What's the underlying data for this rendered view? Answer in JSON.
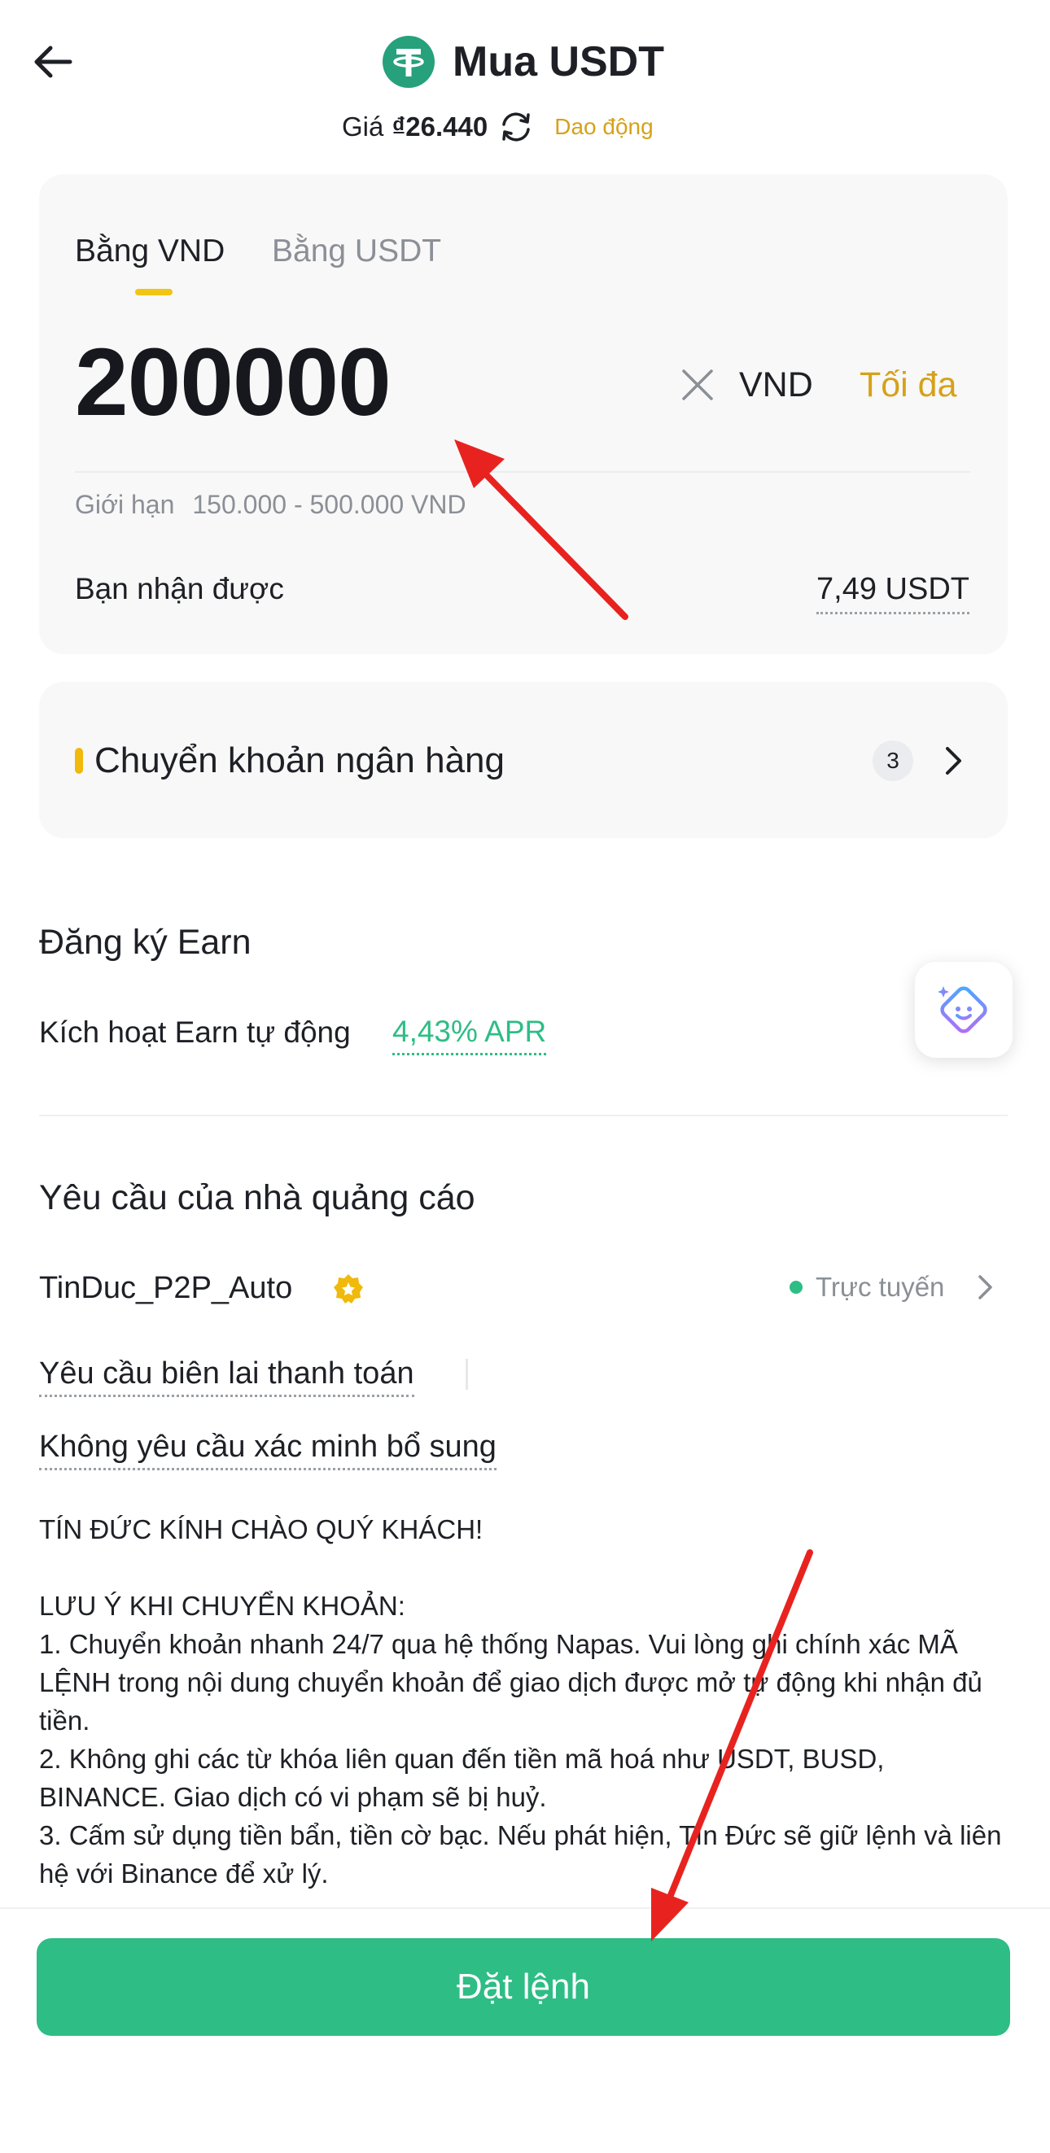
{
  "header": {
    "title": "Mua USDT",
    "price_label": "Giá",
    "price_value": "₫26.440",
    "volatility_label": "Dao động"
  },
  "amount_card": {
    "tabs": [
      {
        "label": "Bằng VND",
        "active": true
      },
      {
        "label": "Bằng USDT",
        "active": false
      }
    ],
    "amount_value": "200000",
    "currency": "VND",
    "max_label": "Tối đa",
    "limit_label": "Giới hạn",
    "limit_value": "150.000 - 500.000 VND",
    "receive_label": "Bạn nhận được",
    "receive_value": "7,49 USDT"
  },
  "payment": {
    "method": "Chuyển khoản ngân hàng",
    "count": "3"
  },
  "earn": {
    "title": "Đăng ký Earn",
    "auto_label": "Kích hoạt Earn tự động",
    "apr": "4,43% APR"
  },
  "advertiser": {
    "section_title": "Yêu cầu của nhà quảng cáo",
    "name": "TinDuc_P2P_Auto",
    "status": "Trực tuyến",
    "tags": [
      "Yêu cầu biên lai thanh toán",
      "Không yêu cầu xác minh bổ sung"
    ],
    "remarks": "TÍN ĐỨC KÍNH CHÀO QUÝ KHÁCH!\n\nLƯU Ý KHI CHUYỂN KHOẢN:\n1. Chuyển khoản nhanh 24/7 qua hệ thống Napas. Vui lòng ghi chính xác MÃ LỆNH trong nội dung chuyển khoản để giao dịch được mở tự động khi nhận đủ tiền.\n2. Không ghi các từ khóa liên quan đến tiền mã hoá như USDT, BUSD, BINANCE. Giao dịch có vi phạm sẽ bị huỷ.\n3. Cấm sử dụng tiền bẩn, tiền cờ bạc. Nếu phát hiện, Tín Đức sẽ giữ lệnh và liên hệ với Binance để xử lý."
  },
  "actions": {
    "place_order": "Đặt lệnh"
  },
  "colors": {
    "accent_yellow": "#f0b90b",
    "accent_gold_text": "#d6a11a",
    "buy_green": "#2ebd85",
    "tether_green": "#26a17b",
    "annotation_red": "#e8231f"
  },
  "icons": [
    "back-arrow-icon",
    "tether-logo-icon",
    "refresh-icon",
    "clear-icon",
    "chevron-right-icon",
    "assistant-bot-icon",
    "verified-badge-icon"
  ]
}
